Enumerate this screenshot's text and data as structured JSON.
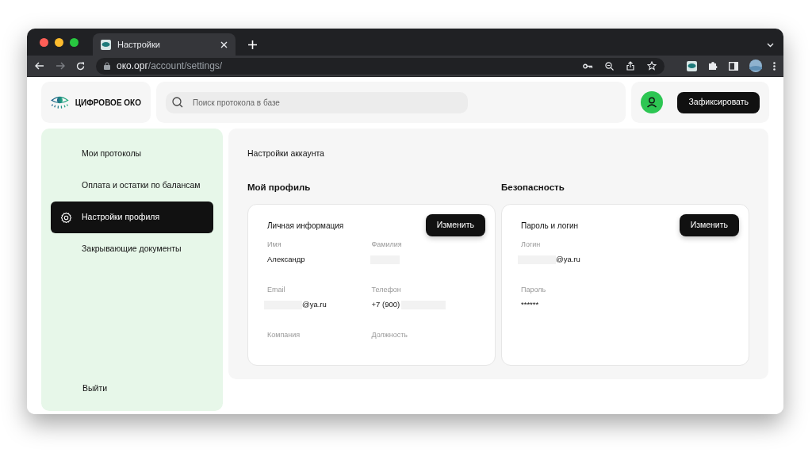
{
  "browser": {
    "tab_title": "Настройки",
    "url_host": "око.орг",
    "url_path": "/account/settings/"
  },
  "header": {
    "logo_text": "ЦИФРОВОЕ ОКО",
    "search": {
      "placeholder": "Поиск протокола в базе"
    },
    "action_button": "Зафиксировать"
  },
  "sidebar": {
    "items": [
      {
        "label": "Мои протоколы",
        "selected": false
      },
      {
        "label": "Оплата и остатки по балансам",
        "selected": false
      },
      {
        "label": "Настройки профиля",
        "selected": true
      },
      {
        "label": "Закрывающие документы",
        "selected": false
      }
    ],
    "logout": "Выйти"
  },
  "main": {
    "title": "Настройки аккаунта",
    "sections": [
      {
        "heading": "Мой профиль",
        "card_title": "Личная информация",
        "button": "Изменить",
        "fields": [
          {
            "label": "Имя",
            "value": "Александр",
            "kind": "plain"
          },
          {
            "label": "Фамилия",
            "kind": "masked"
          },
          {
            "label": "Email",
            "value": "@ya.ru",
            "kind": "masked_prefix"
          },
          {
            "label": "Телефон",
            "value": "+7 (900)",
            "kind": "masked_suffix"
          },
          {
            "label": "Компания",
            "kind": "plain"
          },
          {
            "label": "Должность",
            "kind": "plain"
          }
        ]
      },
      {
        "heading": "Безопасность",
        "card_title": "Пароль и логин",
        "button": "Изменить",
        "fields": [
          {
            "label": "Логин",
            "value": "@ya.ru",
            "kind": "masked_prefix"
          },
          {
            "label": "Пароль",
            "value": "******",
            "kind": "plain"
          }
        ]
      }
    ]
  }
}
